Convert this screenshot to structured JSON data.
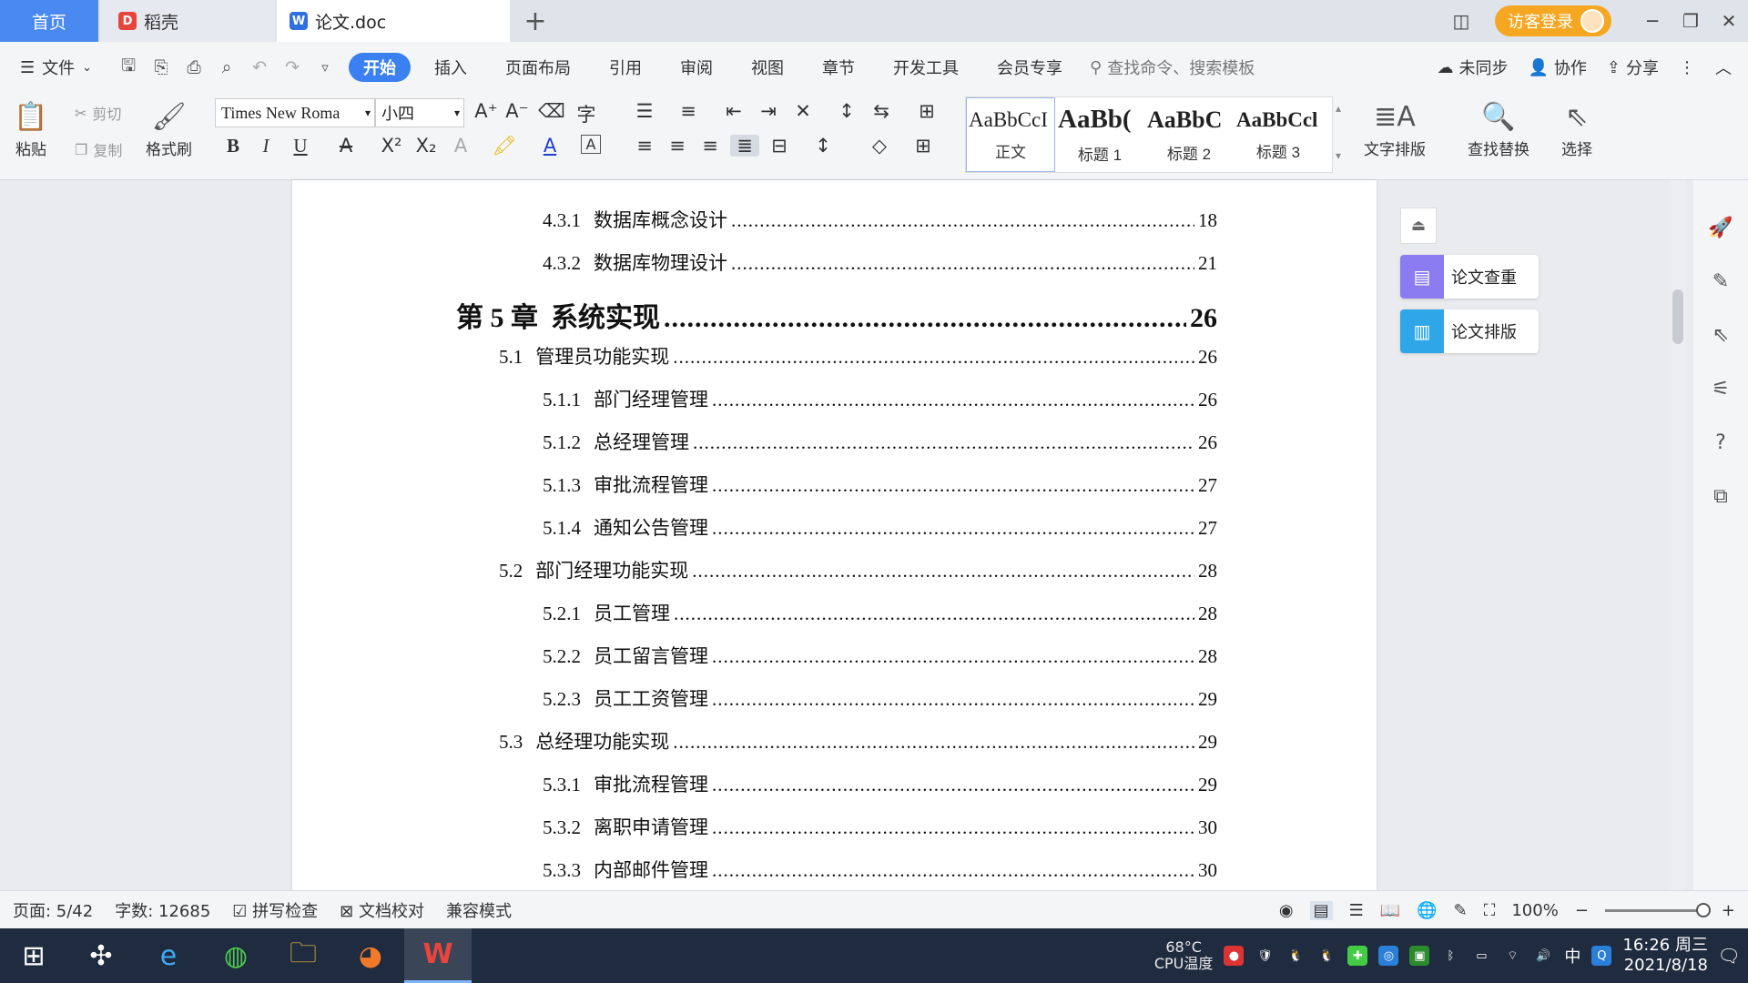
{
  "tabs": {
    "home": "首页",
    "daoke": "稻壳",
    "doc": "论文.doc",
    "add": "+"
  },
  "window": {
    "login": "访客登录"
  },
  "menu": {
    "file": "文件",
    "items": [
      "开始",
      "插入",
      "页面布局",
      "引用",
      "审阅",
      "视图",
      "章节",
      "开发工具",
      "会员专享"
    ],
    "search_placeholder": "查找命令、搜索模板",
    "sync": "未同步",
    "collab": "协作",
    "share": "分享"
  },
  "toolbar": {
    "paste": "粘贴",
    "cut": "剪切",
    "copy": "复制",
    "format_painter": "格式刷",
    "font_name": "Times New Roma",
    "font_size": "小四",
    "styles": [
      {
        "sample": "AaBbCcI",
        "name": "正文"
      },
      {
        "sample": "AaBb(",
        "name": "标题 1"
      },
      {
        "sample": "AaBbC",
        "name": "标题 2"
      },
      {
        "sample": "AaBbCcl",
        "name": "标题 3"
      }
    ],
    "text_layout": "文字排版",
    "find_replace": "查找替换",
    "select": "选择"
  },
  "toc": [
    {
      "level": 3,
      "num": "4.3.1",
      "title": "数据库概念设计",
      "page": "18"
    },
    {
      "level": 3,
      "num": "4.3.2",
      "title": "数据库物理设计",
      "page": "21"
    },
    {
      "level": 1,
      "num": "第 5 章",
      "title": "系统实现",
      "page": "26"
    },
    {
      "level": 2,
      "num": "5.1",
      "title": "管理员功能实现",
      "page": "26"
    },
    {
      "level": 3,
      "num": "5.1.1",
      "title": "部门经理管理",
      "page": "26"
    },
    {
      "level": 3,
      "num": "5.1.2",
      "title": "总经理管理",
      "page": "26"
    },
    {
      "level": 3,
      "num": "5.1.3",
      "title": "审批流程管理",
      "page": "27"
    },
    {
      "level": 3,
      "num": "5.1.4",
      "title": "通知公告管理",
      "page": "27"
    },
    {
      "level": 2,
      "num": "5.2",
      "title": "部门经理功能实现",
      "page": "28"
    },
    {
      "level": 3,
      "num": "5.2.1",
      "title": "员工管理",
      "page": "28"
    },
    {
      "level": 3,
      "num": "5.2.2",
      "title": "员工留言管理",
      "page": "28"
    },
    {
      "level": 3,
      "num": "5.2.3",
      "title": "员工工资管理",
      "page": "29"
    },
    {
      "level": 2,
      "num": "5.3",
      "title": "总经理功能实现",
      "page": "29"
    },
    {
      "level": 3,
      "num": "5.3.1",
      "title": "审批流程管理",
      "page": "29"
    },
    {
      "level": 3,
      "num": "5.3.2",
      "title": "离职申请管理",
      "page": "30"
    },
    {
      "level": 3,
      "num": "5.3.3",
      "title": "内部邮件管理",
      "page": "30"
    }
  ],
  "side_panel": {
    "check": "论文查重",
    "layout": "论文排版"
  },
  "status": {
    "page": "页面: 5/42",
    "words": "字数: 12685",
    "spell": "拼写检查",
    "proof": "文档校对",
    "compat": "兼容模式",
    "zoom": "100%"
  },
  "taskbar": {
    "cpu_temp": "68°C",
    "cpu_label": "CPU温度",
    "ime": "中",
    "time": "16:26 周三",
    "date": "2021/8/18"
  }
}
